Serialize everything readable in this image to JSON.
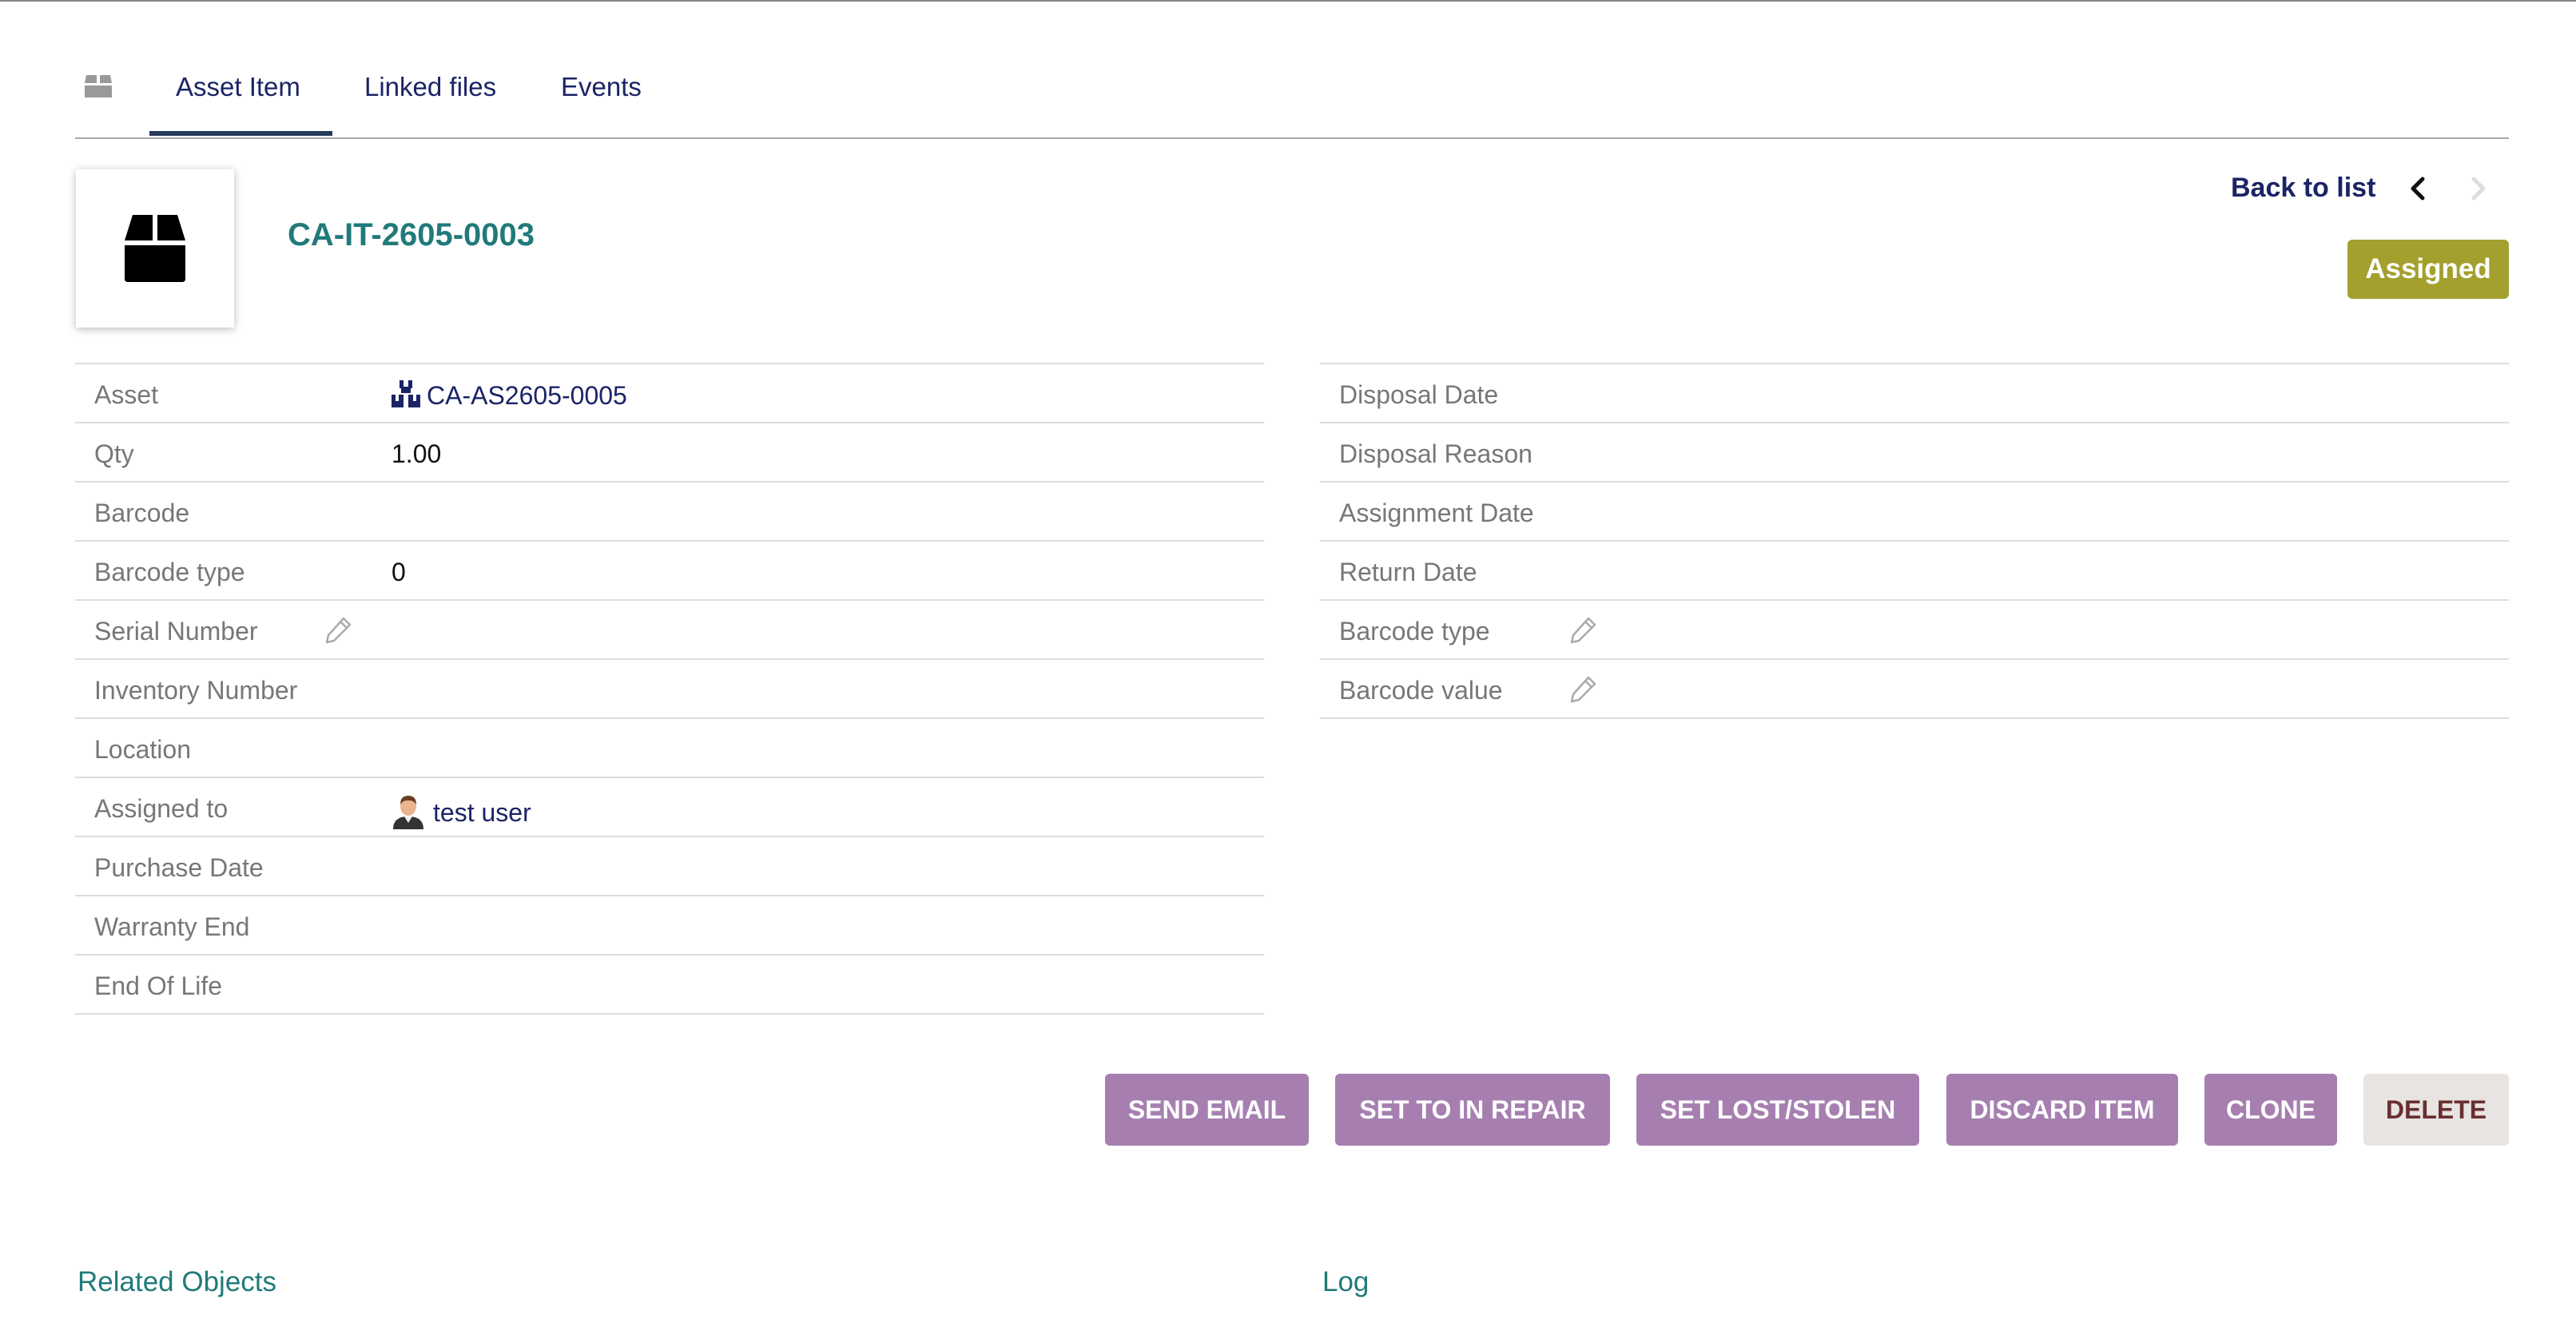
{
  "tabs": [
    {
      "label": "Asset Item",
      "active": true
    },
    {
      "label": "Linked files",
      "active": false
    },
    {
      "label": "Events",
      "active": false
    }
  ],
  "header": {
    "ref": "CA-IT-2605-0003",
    "back_to_list": "Back to list",
    "status_badge": "Assigned",
    "status_color": "#a3a02e"
  },
  "left_fields": [
    {
      "label": "Asset",
      "value": "CA-AS2605-0005",
      "icon": "asset-icon"
    },
    {
      "label": "Qty",
      "value": "1.00"
    },
    {
      "label": "Barcode",
      "value": ""
    },
    {
      "label": "Barcode type",
      "value": "0"
    },
    {
      "label": "Serial Number",
      "value": "",
      "editable": true
    },
    {
      "label": "Inventory Number",
      "value": ""
    },
    {
      "label": "Location",
      "value": ""
    },
    {
      "label": "Assigned to",
      "value": "test user",
      "icon": "user-avatar-icon"
    },
    {
      "label": "Purchase Date",
      "value": ""
    },
    {
      "label": "Warranty End",
      "value": ""
    },
    {
      "label": "End Of Life",
      "value": ""
    }
  ],
  "right_fields": [
    {
      "label": "Disposal Date",
      "value": ""
    },
    {
      "label": "Disposal Reason",
      "value": ""
    },
    {
      "label": "Assignment Date",
      "value": ""
    },
    {
      "label": "Return Date",
      "value": ""
    },
    {
      "label": "Barcode type",
      "value": "",
      "editable": true
    },
    {
      "label": "Barcode value",
      "value": "",
      "editable": true
    }
  ],
  "actions": [
    {
      "label": "SEND EMAIL"
    },
    {
      "label": "SET TO IN REPAIR"
    },
    {
      "label": "SET LOST/STOLEN"
    },
    {
      "label": "DISCARD ITEM"
    },
    {
      "label": "CLONE"
    },
    {
      "label": "DELETE",
      "style": "danger"
    }
  ],
  "sections": {
    "related_objects": "Related Objects",
    "log": "Log"
  },
  "colors": {
    "accent": "#217a7a",
    "link": "#1a2466",
    "action_button": "#a67fb0",
    "delete_button": "#e8e4e2"
  }
}
